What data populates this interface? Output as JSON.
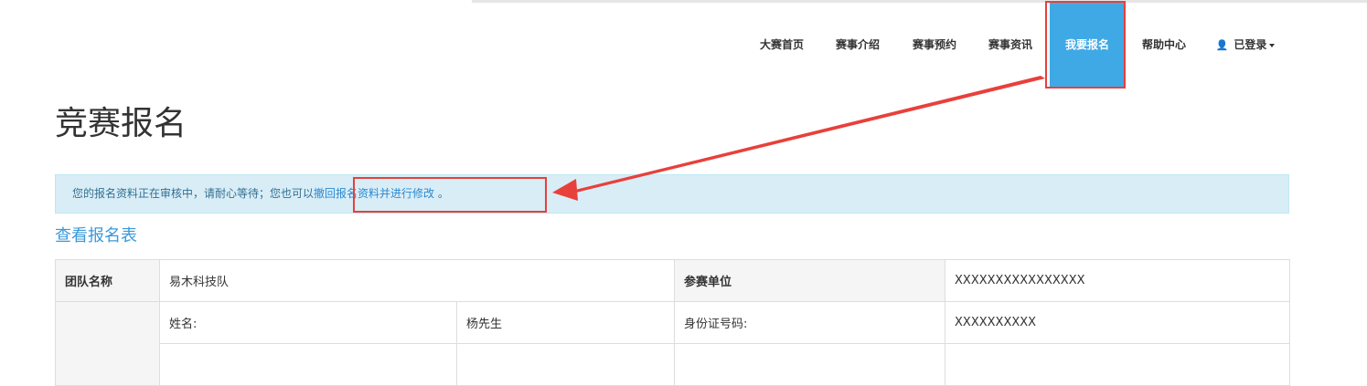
{
  "nav": {
    "items": [
      {
        "label": "大赛首页"
      },
      {
        "label": "赛事介绍"
      },
      {
        "label": "赛事预约"
      },
      {
        "label": "赛事资讯"
      },
      {
        "label": "我要报名"
      },
      {
        "label": "帮助中心"
      },
      {
        "label": "已登录"
      }
    ],
    "active_color": "#3fa9e6"
  },
  "page": {
    "title": "竞赛报名"
  },
  "alert": {
    "text": "您的报名资料正在审核中，请耐心等待；您也可以",
    "link": "撤回报名资料并进行修改",
    "suffix": "。"
  },
  "view_link": "查看报名表",
  "table": {
    "team_label": "团队名称",
    "team_value": "易木科技队",
    "unit_label": "参赛单位",
    "unit_value": "XXXXXXXXXXXXXXXX",
    "name_label": "姓名:",
    "name_value": "杨先生",
    "id_label": "身份证号码:",
    "id_value": "XXXXXXXXXX"
  },
  "annotation_color": "#e8403b"
}
